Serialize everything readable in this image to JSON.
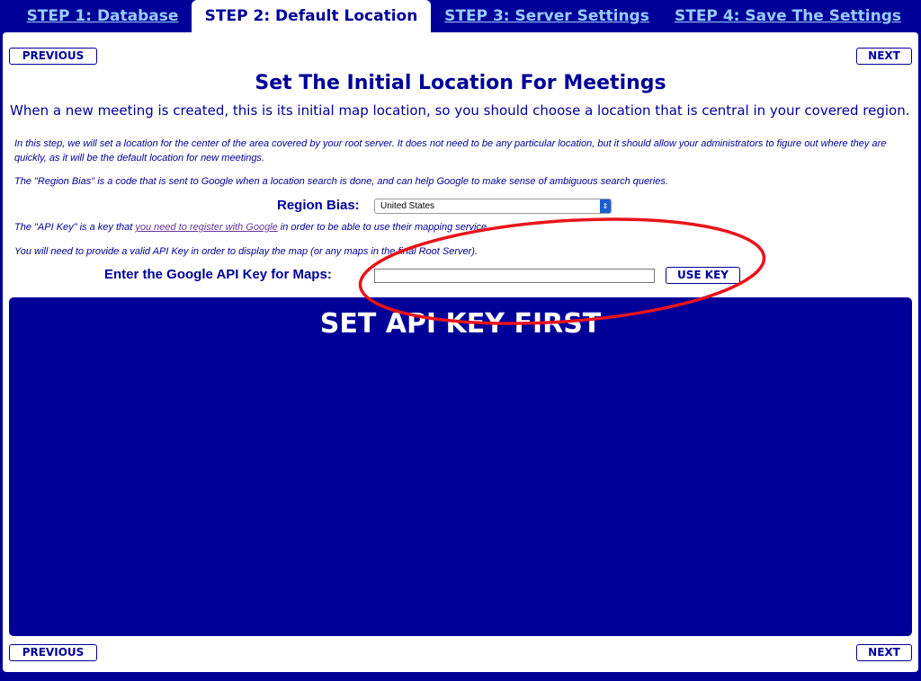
{
  "tabs": [
    {
      "label": "STEP 1: Database",
      "active": false
    },
    {
      "label": "STEP 2: Default Location",
      "active": true
    },
    {
      "label": "STEP 3: Server Settings",
      "active": false
    },
    {
      "label": "STEP 4: Save The Settings",
      "active": false
    }
  ],
  "nav": {
    "previous": "PREVIOUS",
    "next": "NEXT"
  },
  "title": "Set The Initial Location For Meetings",
  "subtitle": "When a new meeting is created, this is its initial map location, so you should choose a location that is central in your covered region.",
  "intro": "In this step, we will set a location for the center of the area covered by your root server. It does not need to be any particular location, but it should allow your administrators to figure out where they are quickly, as it will be the default location for new meetings.",
  "region_info": "The \"Region Bias\" is a code that is sent to Google when a location search is done, and can help Google to make sense of ambiguous search queries.",
  "region_label": "Region Bias:",
  "region_value": "United States",
  "api_info_pre": "The \"API Key\" is a key that ",
  "api_info_link": "you need to register with Google",
  "api_info_post": " in order to be able to use their mapping service.",
  "api_required": "You will need to provide a valid API Key in order to display the map (or any maps in the final Root Server).",
  "api_label": "Enter the Google API Key for Maps:",
  "api_value": "",
  "use_key": "USE KEY",
  "map_message": "SET API KEY FIRST",
  "colors": {
    "primary": "#000099",
    "tab_link": "#99ccff",
    "annotation": "#e8141b"
  }
}
